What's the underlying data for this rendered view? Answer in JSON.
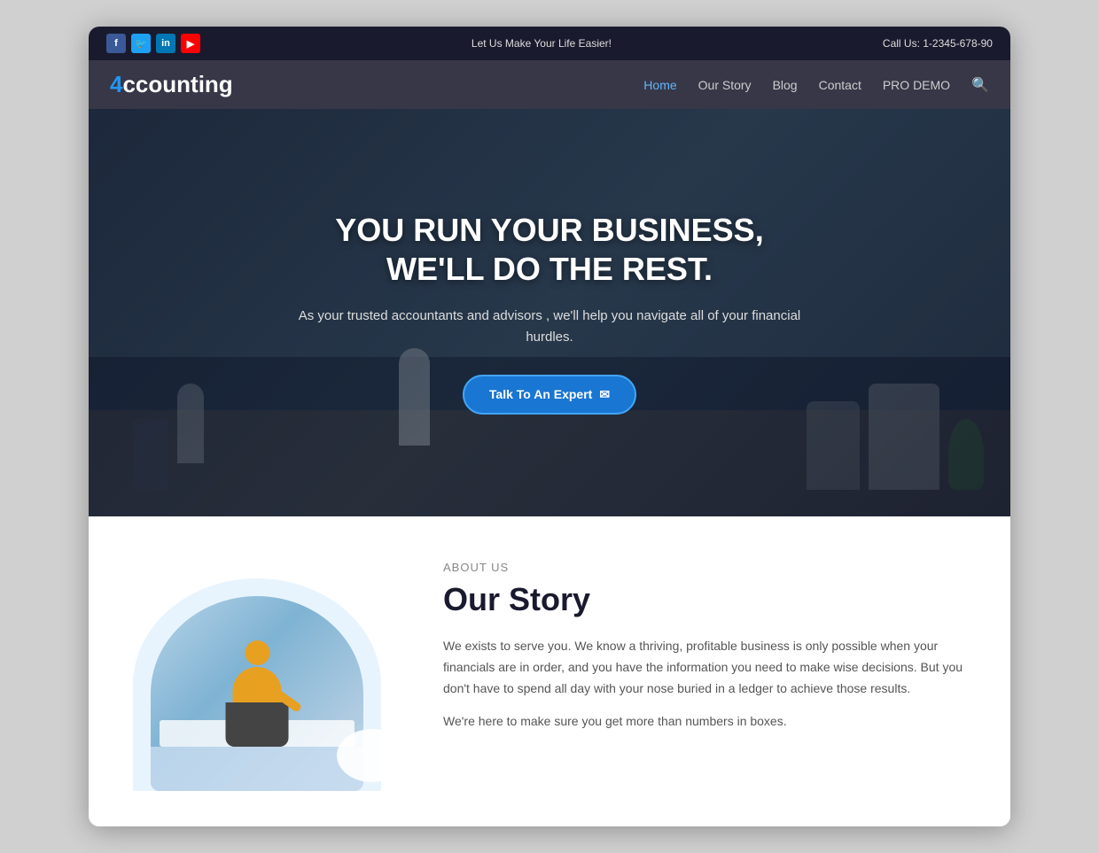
{
  "topbar": {
    "social": [
      "fb",
      "tw",
      "li",
      "yt"
    ],
    "tagline": "Let Us Make Your Life Easier!",
    "phone": "Call Us: 1-2345-678-90"
  },
  "navbar": {
    "logo_accent": "4",
    "logo_text": "ccounting",
    "links": [
      {
        "label": "Home",
        "active": true
      },
      {
        "label": "Our Story",
        "active": false
      },
      {
        "label": "Blog",
        "active": false
      },
      {
        "label": "Contact",
        "active": false
      },
      {
        "label": "PRO DEMO",
        "active": false
      }
    ]
  },
  "hero": {
    "title": "YOU RUN YOUR BUSINESS, WE'LL DO THE REST.",
    "subtitle": "As your trusted accountants and advisors , we'll help you navigate all of your financial hurdles.",
    "cta_label": "Talk To An Expert"
  },
  "about": {
    "label": "About Us",
    "title": "Our Story",
    "body1": "We exists to serve you. We know a thriving, profitable business is only possible when your financials are in order, and you have the information you need to make wise decisions. But you don't have to spend all day with your nose buried in a ledger to achieve those results.",
    "body2": "We're here to make sure you get more than numbers in boxes."
  }
}
